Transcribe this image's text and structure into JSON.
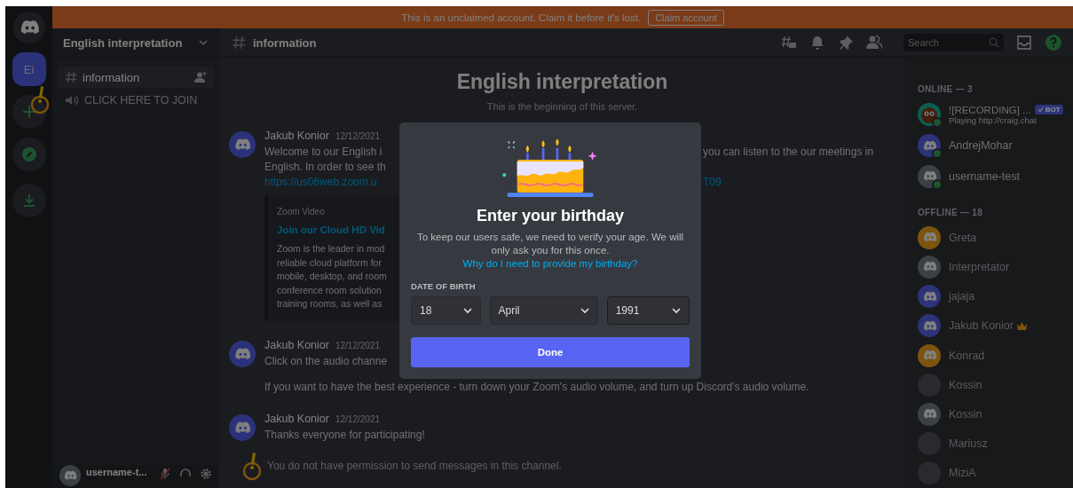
{
  "banner": {
    "text": "This is an unclaimed account. Claim it before it's lost.",
    "button": "Claim account"
  },
  "servers": [
    {
      "kind": "home",
      "selected": false
    },
    {
      "kind": "server",
      "label": "Ei",
      "selected": true
    },
    {
      "kind": "add",
      "selected": false
    },
    {
      "kind": "explore",
      "selected": false
    },
    {
      "kind": "download",
      "selected": false
    }
  ],
  "channel_sidebar": {
    "server_name": "English interpretation",
    "channels": [
      {
        "kind": "text",
        "name": "information",
        "selected": true
      },
      {
        "kind": "voice",
        "name": "CLICK HERE TO JOIN",
        "selected": false
      }
    ],
    "user": {
      "name": "username-t..."
    }
  },
  "header": {
    "channel": "information",
    "search": {
      "placeholder": "Search"
    }
  },
  "welcome": {
    "title": "English interpretation",
    "subtitle": "This is the beginning of this server."
  },
  "messages": [
    {
      "author": "Jakub Konior",
      "time": "12/12/2021",
      "lines": [
        {
          "kind": "text",
          "left": "Welcome to our English i",
          "right": "you can listen to the our meetings in"
        },
        {
          "kind": "text",
          "left": "English. In order to see th"
        },
        {
          "kind": "link",
          "left": "https://us06web.zoom.u",
          "right": "T09"
        }
      ],
      "embed": {
        "provider": "Zoom Video",
        "title": "Join our Cloud HD Vid",
        "description": [
          "Zoom is the leader in mod",
          "reliable cloud platform for",
          "mobile, desktop, and room",
          "conference room solution",
          "training rooms, as well as"
        ]
      }
    },
    {
      "author": "Jakub Konior",
      "time": "12/12/2021",
      "lines": [
        {
          "kind": "text",
          "left": "Click on the audio channe"
        },
        {
          "kind": "text",
          "text": "If you want to have the best experience - turn down your Zoom's audio volume, and turn up Discord's audio volume."
        }
      ]
    },
    {
      "author": "Jakub Konior",
      "time": "12/12/2021",
      "lines": [
        {
          "kind": "text",
          "text": "Thanks everyone for participating!"
        }
      ]
    }
  ],
  "notice": "You do not have permission to send messages in this channel.",
  "member_list": {
    "groups": [
      {
        "heading": "ONLINE — 3",
        "members": [
          {
            "kind": "bot",
            "name": "![RECORDING] ...",
            "bot_tag": "BOT",
            "activity": "Playing http://craig.chat",
            "online": true,
            "owner": false
          },
          {
            "kind": "logo",
            "name": "AndrejMohar",
            "color": "#2c3379",
            "online": true,
            "owner": false
          },
          {
            "kind": "logo",
            "name": "username-test",
            "color": "#3a4046",
            "online": true,
            "owner": false
          }
        ]
      },
      {
        "heading": "OFFLINE — 18",
        "members": [
          {
            "kind": "logo",
            "name": "Greta",
            "color": "#7d540d",
            "online": false,
            "owner": false
          },
          {
            "kind": "logo",
            "name": "Interpretator",
            "color": "#3a4046",
            "online": false,
            "owner": false
          },
          {
            "kind": "logo",
            "name": "jajaja",
            "color": "#2c3379",
            "online": false,
            "owner": false
          },
          {
            "kind": "logo",
            "name": "Jakub Konior",
            "color": "#2c3379",
            "online": false,
            "owner": true
          },
          {
            "kind": "logo",
            "name": "Konrad",
            "color": "#7d540d",
            "online": false,
            "owner": false
          },
          {
            "kind": "photo",
            "name": "Kossin",
            "online": false,
            "owner": false
          },
          {
            "kind": "logo",
            "name": "Kossin",
            "color": "#3a4046",
            "online": false,
            "owner": false
          },
          {
            "kind": "photo",
            "name": "Mariusz",
            "online": false,
            "owner": false
          },
          {
            "kind": "photo",
            "name": "MiziA",
            "online": false,
            "owner": false
          }
        ]
      }
    ]
  },
  "modal": {
    "title": "Enter your birthday",
    "text": "To keep our users safe, we need to verify your age. We will only ask you for this once.",
    "link": "Why do I need to provide my birthday?",
    "field_label": "DATE OF BIRTH",
    "selects": [
      {
        "value": "18"
      },
      {
        "value": "April"
      },
      {
        "value": "1991"
      }
    ],
    "button": "Done"
  }
}
